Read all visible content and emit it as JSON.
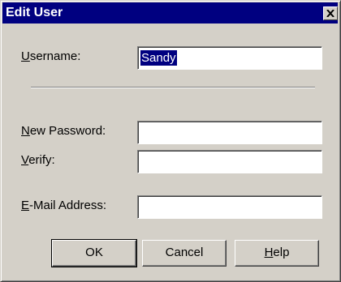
{
  "window": {
    "title": "Edit User",
    "close_icon": "close-x-icon"
  },
  "form": {
    "username": {
      "label_hotkey": "U",
      "label_rest": "sername:",
      "value": "Sandy"
    },
    "new_password": {
      "label_hotkey": "N",
      "label_rest": "ew Password:",
      "value": ""
    },
    "verify": {
      "label_hotkey": "V",
      "label_rest": "erify:",
      "value": ""
    },
    "email": {
      "label_hotkey": "E",
      "label_rest": "-Mail Address:",
      "value": ""
    }
  },
  "buttons": {
    "ok": "OK",
    "cancel": "Cancel",
    "help_hotkey": "H",
    "help_rest": "elp"
  },
  "colors": {
    "titlebar": "#000080",
    "face": "#d4d0c8",
    "selection": "#000080"
  }
}
